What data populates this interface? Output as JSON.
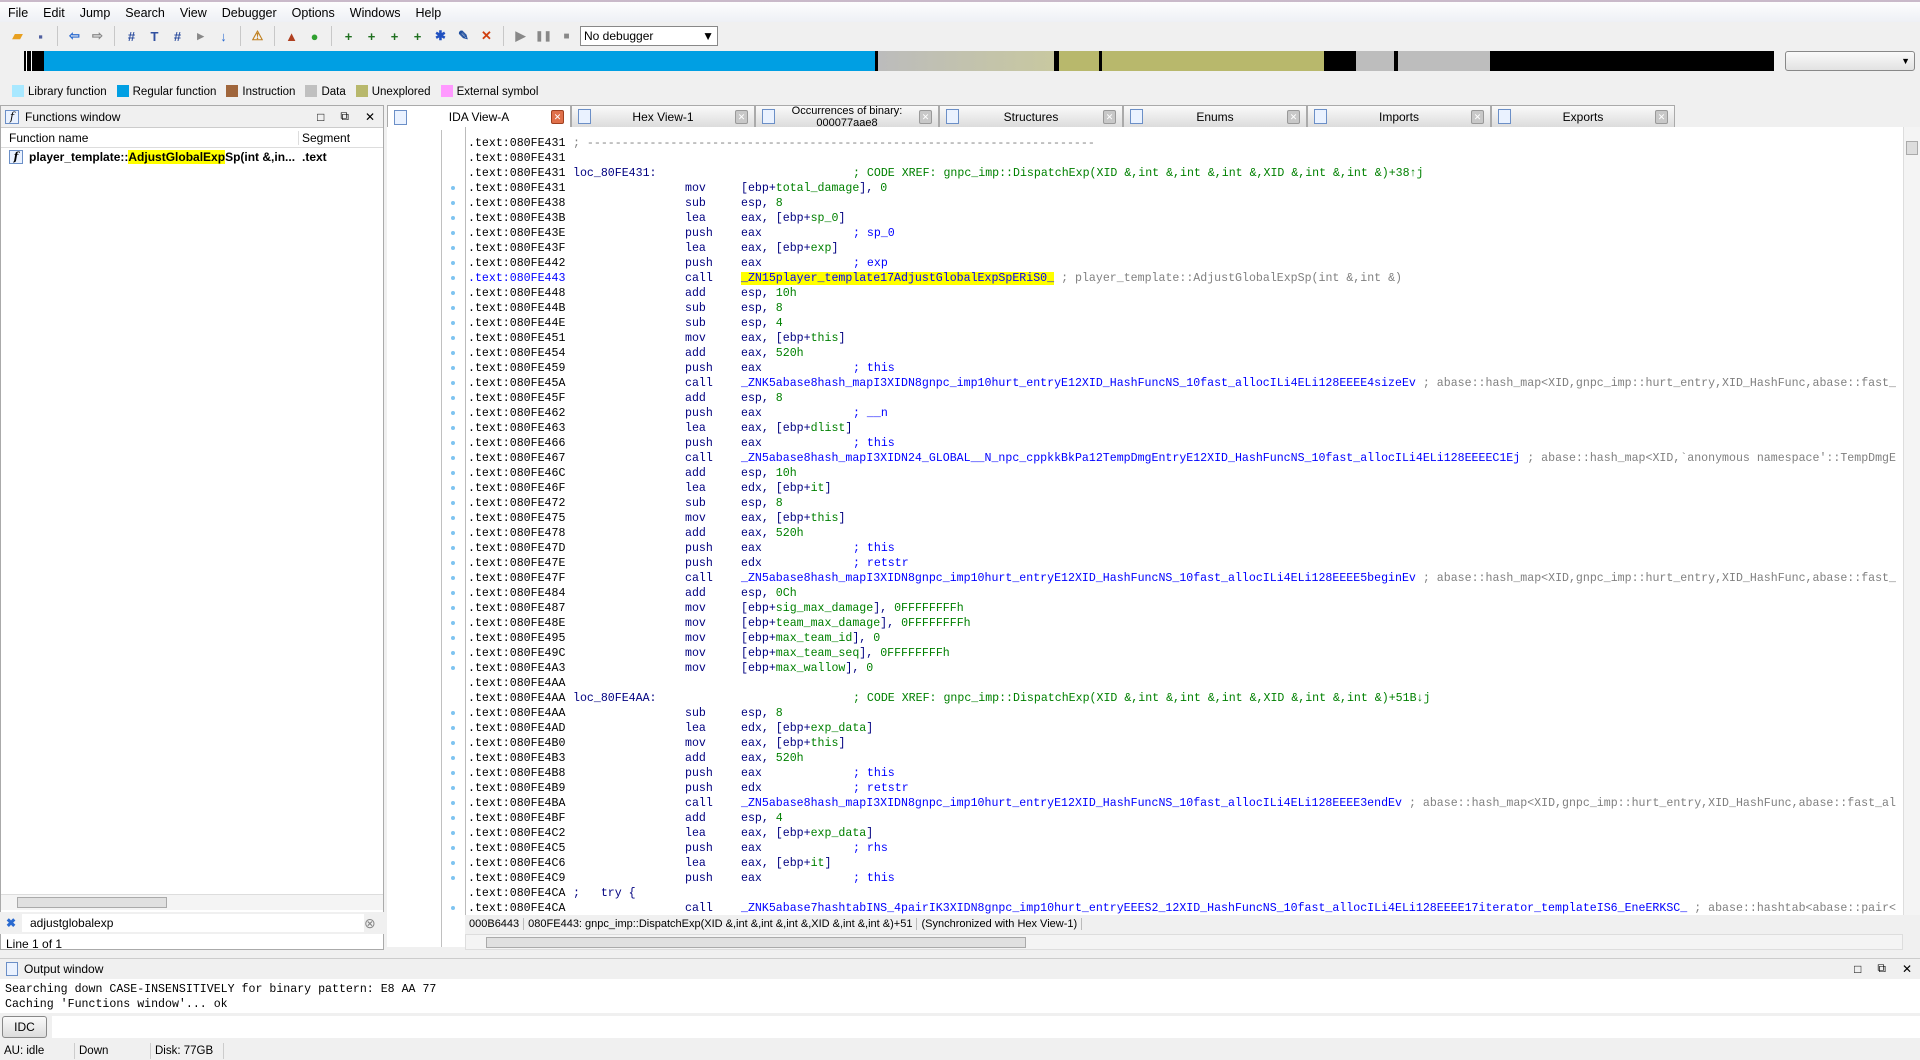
{
  "menu": [
    "File",
    "Edit",
    "Jump",
    "Search",
    "View",
    "Debugger",
    "Options",
    "Windows",
    "Help"
  ],
  "toolbar": {
    "icons": [
      "open-icon",
      "save-icon",
      "back-icon",
      "forward-icon",
      "search-text-icon",
      "search-binary-icon",
      "search-immediate-icon",
      "search-next-icon",
      "jump-icon",
      "analyze-icon",
      "graph-icon",
      "green-circle-icon",
      "code-icon",
      "data-icon",
      "string-icon",
      "struct-icon",
      "name-icon",
      "edit-icon",
      "delete-icon",
      "run-icon",
      "pause-icon",
      "stop-icon"
    ],
    "debugger_select": "No debugger"
  },
  "legend": [
    {
      "label": "Library function",
      "color": "#a8e8ff"
    },
    {
      "label": "Regular function",
      "color": "#009fe3"
    },
    {
      "label": "Instruction",
      "color": "#a0663c"
    },
    {
      "label": "Data",
      "color": "#c0c0c0"
    },
    {
      "label": "Unexplored",
      "color": "#b8b86c"
    },
    {
      "label": "External symbol",
      "color": "#ff99ff"
    }
  ],
  "functions_window": {
    "title": "Functions window",
    "col_name": "Function name",
    "col_segment": "Segment",
    "rows": [
      {
        "pre": "player_template::",
        "match": "AdjustGlobalExp",
        "post": "Sp(int &,in...",
        "segment": ".text"
      }
    ],
    "search_value": "adjustglobalexp",
    "line_info": "Line 1 of 1"
  },
  "tabs": [
    {
      "label": "IDA View-A",
      "active": true
    },
    {
      "label": "Hex View-1"
    },
    {
      "label": "Occurrences of binary: 000077aae8"
    },
    {
      "label": "Structures"
    },
    {
      "label": "Enums"
    },
    {
      "label": "Imports"
    },
    {
      "label": "Exports"
    }
  ],
  "code": [
    {
      "a": ".text:080FE431",
      "l": "; -------------------------------------------------------------------------"
    },
    {
      "a": ".text:080FE431"
    },
    {
      "a": ".text:080FE431",
      "l": "loc_80FE431:",
      "x": "; CODE XREF: gnpc_imp::DispatchExp(XID &,int &,int &,int &,XID &,int &,int &)+38↑j"
    },
    {
      "a": ".text:080FE431",
      "m": "mov",
      "o": "[ebp+total_damage], 0"
    },
    {
      "a": ".text:080FE438",
      "m": "sub",
      "o": "esp, 8"
    },
    {
      "a": ".text:080FE43B",
      "m": "lea",
      "o": "eax, [ebp+sp_0]"
    },
    {
      "a": ".text:080FE43E",
      "m": "push",
      "o": "eax",
      "c": "; sp_0"
    },
    {
      "a": ".text:080FE43F",
      "m": "lea",
      "o": "eax, [ebp+exp]"
    },
    {
      "a": ".text:080FE442",
      "m": "push",
      "o": "eax",
      "c": "; exp"
    },
    {
      "a": ".text:080FE443",
      "m": "call",
      "f": "_ZN15player_template17AdjustGlobalExpSpERiS0_",
      "d": "; player_template::AdjustGlobalExpSp(int &,int &)",
      "sel": true
    },
    {
      "a": ".text:080FE448",
      "m": "add",
      "o": "esp, 10h"
    },
    {
      "a": ".text:080FE44B",
      "m": "sub",
      "o": "esp, 8"
    },
    {
      "a": ".text:080FE44E",
      "m": "sub",
      "o": "esp, 4"
    },
    {
      "a": ".text:080FE451",
      "m": "mov",
      "o": "eax, [ebp+this]"
    },
    {
      "a": ".text:080FE454",
      "m": "add",
      "o": "eax, 520h"
    },
    {
      "a": ".text:080FE459",
      "m": "push",
      "o": "eax",
      "c": "; this"
    },
    {
      "a": ".text:080FE45A",
      "m": "call",
      "f": "_ZNK5abase8hash_mapI3XIDN8gnpc_imp10hurt_entryE12XID_HashFuncNS_10fast_allocILi4ELi128EEEE4sizeEv",
      "d": "; abase::hash_map<XID,gnpc_imp::hurt_entry,XID_HashFunc,abase::fast_"
    },
    {
      "a": ".text:080FE45F",
      "m": "add",
      "o": "esp, 8"
    },
    {
      "a": ".text:080FE462",
      "m": "push",
      "o": "eax",
      "c": "; __n"
    },
    {
      "a": ".text:080FE463",
      "m": "lea",
      "o": "eax, [ebp+dlist]"
    },
    {
      "a": ".text:080FE466",
      "m": "push",
      "o": "eax",
      "c": "; this"
    },
    {
      "a": ".text:080FE467",
      "m": "call",
      "f": "_ZN5abase8hash_mapI3XIDN24_GLOBAL__N_npc_cppkkBkPa12TempDmgEntryE12XID_HashFuncNS_10fast_allocILi4ELi128EEEEC1Ej",
      "d": "; abase::hash_map<XID,`anonymous namespace'::TempDmgE"
    },
    {
      "a": ".text:080FE46C",
      "m": "add",
      "o": "esp, 10h"
    },
    {
      "a": ".text:080FE46F",
      "m": "lea",
      "o": "edx, [ebp+it]"
    },
    {
      "a": ".text:080FE472",
      "m": "sub",
      "o": "esp, 8"
    },
    {
      "a": ".text:080FE475",
      "m": "mov",
      "o": "eax, [ebp+this]"
    },
    {
      "a": ".text:080FE478",
      "m": "add",
      "o": "eax, 520h"
    },
    {
      "a": ".text:080FE47D",
      "m": "push",
      "o": "eax",
      "c": "; this"
    },
    {
      "a": ".text:080FE47E",
      "m": "push",
      "o": "edx",
      "c": "; retstr"
    },
    {
      "a": ".text:080FE47F",
      "m": "call",
      "f": "_ZN5abase8hash_mapI3XIDN8gnpc_imp10hurt_entryE12XID_HashFuncNS_10fast_allocILi4ELi128EEEE5beginEv",
      "d": "; abase::hash_map<XID,gnpc_imp::hurt_entry,XID_HashFunc,abase::fast_"
    },
    {
      "a": ".text:080FE484",
      "m": "add",
      "o": "esp, 0Ch"
    },
    {
      "a": ".text:080FE487",
      "m": "mov",
      "o": "[ebp+sig_max_damage], 0FFFFFFFFh"
    },
    {
      "a": ".text:080FE48E",
      "m": "mov",
      "o": "[ebp+team_max_damage], 0FFFFFFFFh"
    },
    {
      "a": ".text:080FE495",
      "m": "mov",
      "o": "[ebp+max_team_id], 0"
    },
    {
      "a": ".text:080FE49C",
      "m": "mov",
      "o": "[ebp+max_team_seq], 0FFFFFFFFh"
    },
    {
      "a": ".text:080FE4A3",
      "m": "mov",
      "o": "[ebp+max_wallow], 0"
    },
    {
      "a": ".text:080FE4AA"
    },
    {
      "a": ".text:080FE4AA",
      "l": "loc_80FE4AA:",
      "x": "; CODE XREF: gnpc_imp::DispatchExp(XID &,int &,int &,int &,XID &,int &,int &)+51B↓j"
    },
    {
      "a": ".text:080FE4AA",
      "m": "sub",
      "o": "esp, 8"
    },
    {
      "a": ".text:080FE4AD",
      "m": "lea",
      "o": "edx, [ebp+exp_data]"
    },
    {
      "a": ".text:080FE4B0",
      "m": "mov",
      "o": "eax, [ebp+this]"
    },
    {
      "a": ".text:080FE4B3",
      "m": "add",
      "o": "eax, 520h"
    },
    {
      "a": ".text:080FE4B8",
      "m": "push",
      "o": "eax",
      "c": "; this"
    },
    {
      "a": ".text:080FE4B9",
      "m": "push",
      "o": "edx",
      "c": "; retstr"
    },
    {
      "a": ".text:080FE4BA",
      "m": "call",
      "f": "_ZN5abase8hash_mapI3XIDN8gnpc_imp10hurt_entryE12XID_HashFuncNS_10fast_allocILi4ELi128EEEE3endEv",
      "d": "; abase::hash_map<XID,gnpc_imp::hurt_entry,XID_HashFunc,abase::fast_al"
    },
    {
      "a": ".text:080FE4BF",
      "m": "add",
      "o": "esp, 4"
    },
    {
      "a": ".text:080FE4C2",
      "m": "lea",
      "o": "eax, [ebp+exp_data]"
    },
    {
      "a": ".text:080FE4C5",
      "m": "push",
      "o": "eax",
      "c": "; rhs"
    },
    {
      "a": ".text:080FE4C6",
      "m": "lea",
      "o": "eax, [ebp+it]"
    },
    {
      "a": ".text:080FE4C9",
      "m": "push",
      "o": "eax",
      "c": "; this"
    },
    {
      "a": ".text:080FE4CA",
      "t": ";   try {"
    },
    {
      "a": ".text:080FE4CA",
      "m": "call",
      "f": "_ZNK5abase7hashtabINS_4pairIK3XIDN8gnpc_imp10hurt_entryEEES2_12XID_HashFuncNS_10fast_allocILi4ELi128EEEE17iterator_templateIS6_EneERKSC_",
      "d": "; abase::hashtab<abase::pair<"
    }
  ],
  "code_status": {
    "offset": "000B6443",
    "location": "080FE443: gnpc_imp::DispatchExp(XID &,int &,int &,int &,XID &,int &,int &)+51",
    "sync": "(Synchronized with Hex View-1)"
  },
  "output": {
    "title": "Output window",
    "lines": [
      "Searching down CASE-INSENSITIVELY for binary pattern: E8 AA 77",
      "Caching 'Functions window'... ok"
    ],
    "idc_label": "IDC"
  },
  "status": [
    "AU:  idle",
    "Down",
    "Disk: 77GB"
  ],
  "colors": {
    "highlight": "#ffff00",
    "regular_function": "#009fe3",
    "unexplored": "#b8b86c"
  }
}
